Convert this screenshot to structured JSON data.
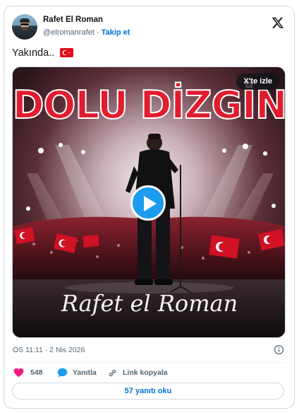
{
  "author": {
    "name": "Rafet El Roman",
    "handle": "@elromanrafet",
    "separator": " · ",
    "follow_label": "Takip et"
  },
  "tweet": {
    "text": "Yakında.."
  },
  "media": {
    "headline": "DOLU DİZGİN",
    "signature": "Rafet el Roman",
    "watch_label": "X'te izle"
  },
  "timestamp": "ÖS 11:11 · 2 Nis 2026",
  "actions": {
    "like_count": "548",
    "reply_label": "Yanıtla",
    "copy_link_label": "Link kopyala"
  },
  "read_replies_label": "57 yanıtı oku",
  "icons": {
    "brand": "x-logo-icon",
    "like": "heart-icon",
    "reply": "speech-bubble-icon",
    "link": "link-icon",
    "info": "info-icon",
    "play": "play-icon",
    "flag": "turkey-flag-icon"
  },
  "colors": {
    "accent": "#1d9bf0",
    "link": "#006fd6",
    "heart": "#f91880",
    "muted": "#536471",
    "flag_red": "#e30a17"
  }
}
